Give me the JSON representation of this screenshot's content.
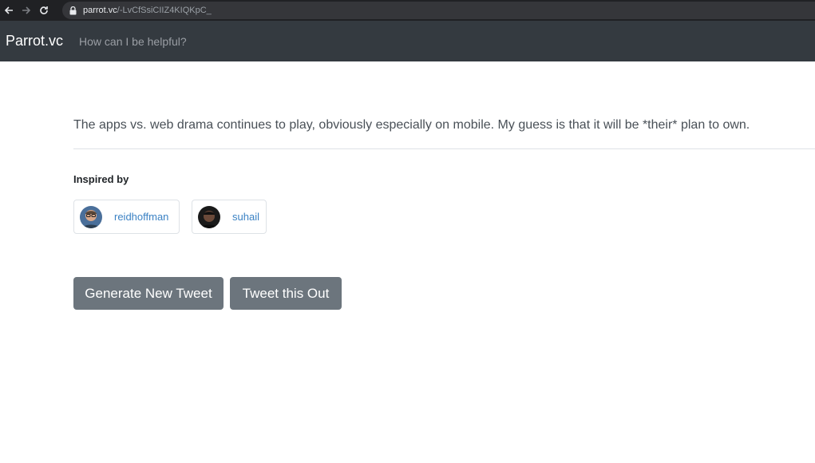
{
  "browser": {
    "back_icon": "arrow-left-icon",
    "forward_icon": "arrow-right-icon",
    "reload_icon": "reload-icon",
    "lock_icon": "lock-icon",
    "url_host": "parrot.vc",
    "url_path": "/-LvCfSsiCIIZ4KIQKpC_"
  },
  "navbar": {
    "brand": "Parrot.vc",
    "link": "How can I be helpful?"
  },
  "tweet": {
    "text": "The apps vs. web drama continues to play, obviously especially on mobile. My guess is that it will be *their* plan to own."
  },
  "inspired": {
    "heading": "Inspired by",
    "users": [
      {
        "handle": "reidhoffman"
      },
      {
        "handle": "suhail"
      }
    ]
  },
  "actions": {
    "generate_label": "Generate New Tweet",
    "tweet_label": "Tweet this Out"
  },
  "colors": {
    "navbar_bg": "#343a40",
    "button_bg": "#6c757d",
    "link": "#3b82c4"
  }
}
